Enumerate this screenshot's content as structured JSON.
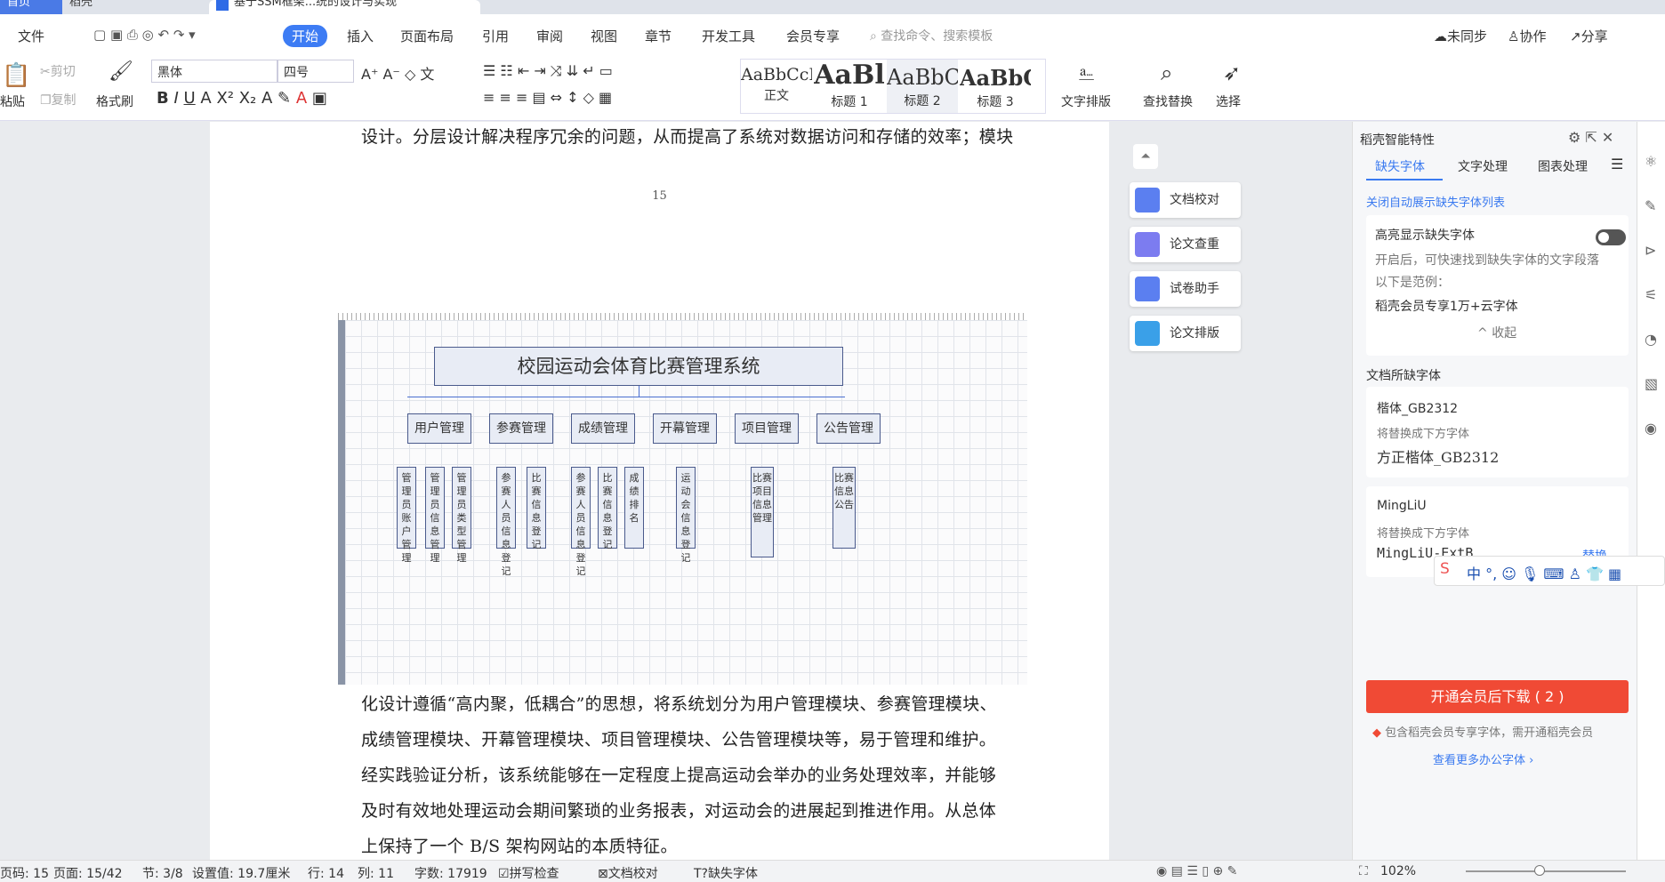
{
  "tabs": {
    "home": "首页",
    "daoke": "稻壳",
    "doc": "基于SSM框架...统的设计与实现"
  },
  "menu": {
    "file": "文件",
    "start": "开始",
    "insert": "插入",
    "layout": "页面布局",
    "ref": "引用",
    "review": "审阅",
    "view": "视图",
    "chapter": "章节",
    "dev": "开发工具",
    "vip": "会员专享",
    "search": "查找命令、搜索模板",
    "unsync": "未同步",
    "collab": "协作",
    "share": "分享"
  },
  "ribbon": {
    "paste": "粘贴",
    "cut": "剪切",
    "copy": "复制",
    "format_painter": "格式刷",
    "font": "黑体",
    "size": "四号",
    "styles": [
      {
        "preview": "AaBbCcI",
        "name": "正文"
      },
      {
        "preview": "AaBl",
        "name": "标题 1"
      },
      {
        "preview": "AaBbC",
        "name": "标题 2"
      },
      {
        "preview": "AaBbC",
        "name": "标题 3"
      }
    ],
    "text_layout": "文字排版",
    "find_replace": "查找替换",
    "select": "选择"
  },
  "doc": {
    "top_line": "设计。分层设计解决程序冗余的问题，从而提高了系统对数据访问和存储的效率；模块",
    "page_no": "15",
    "chart": {
      "title": "校园运动会体育比赛管理系统",
      "modules": [
        "用户管理",
        "参赛管理",
        "成绩管理",
        "开幕管理",
        "项目管理",
        "公告管理"
      ],
      "leaves": [
        "管理员账户管理",
        "管理员信息管理",
        "管理员类型管理",
        "参赛人员信息登记",
        "比赛信息登记",
        "参赛人员信息登记",
        "比赛信息登记",
        "成绩排名",
        "运动会信息登记",
        "比赛项目信息管理",
        "比赛信息公告"
      ]
    },
    "para": [
      "化设计遵循“高内聚，低耦合”的思想，将系统划分为用户管理模块、参赛管理模块、",
      "成绩管理模块、开幕管理模块、项目管理模块、公告管理模块等，易于管理和维护。",
      "经实践验证分析，该系统能够在一定程度上提高运动会举办的业务处理效率，并能够",
      "及时有效地处理运动会期间繁琐的业务报表，对运动会的进展起到推进作用。从总体",
      "上保持了一个 B/S 架构网站的本质特征。"
    ]
  },
  "tools": [
    "文档校对",
    "论文查重",
    "试卷助手",
    "论文排版"
  ],
  "panel": {
    "title": "稻壳智能特性",
    "tabs": [
      "缺失字体",
      "文字处理",
      "图表处理"
    ],
    "close_auto": "关闭自动展示缺失字体列表",
    "highlight": "高亮显示缺失字体",
    "desc1": "开启后，可快速找到缺失字体的文字段落",
    "desc2": "以下是范例：",
    "desc3": "稻壳会员专享1万+云字体",
    "collapse": "收起",
    "missing_title": "文档所缺字体",
    "f1": "楷体_GB2312",
    "f1_rep": "将替换成下方字体",
    "f1_new": "方正楷体_GB2312",
    "f2": "MingLiU",
    "f2_rep": "将替换成下方字体",
    "f2_new": "MingLiU-ExtB",
    "replace": "替换",
    "download": "开通会员后下载 ( 2 )",
    "notice": "包含稻壳会员专享字体，需开通稻壳会员",
    "more": "查看更多办公字体"
  },
  "status": {
    "pagecode": "页码: 15",
    "page": "页面: 15/42",
    "section": "节: 3/8",
    "setting": "设置值: 19.7厘米",
    "row": "行: 14",
    "col": "列: 11",
    "words": "字数: 17919",
    "spell": "拼写检查",
    "proof": "文档校对",
    "missing": "缺失字体",
    "zoom": "102%"
  }
}
